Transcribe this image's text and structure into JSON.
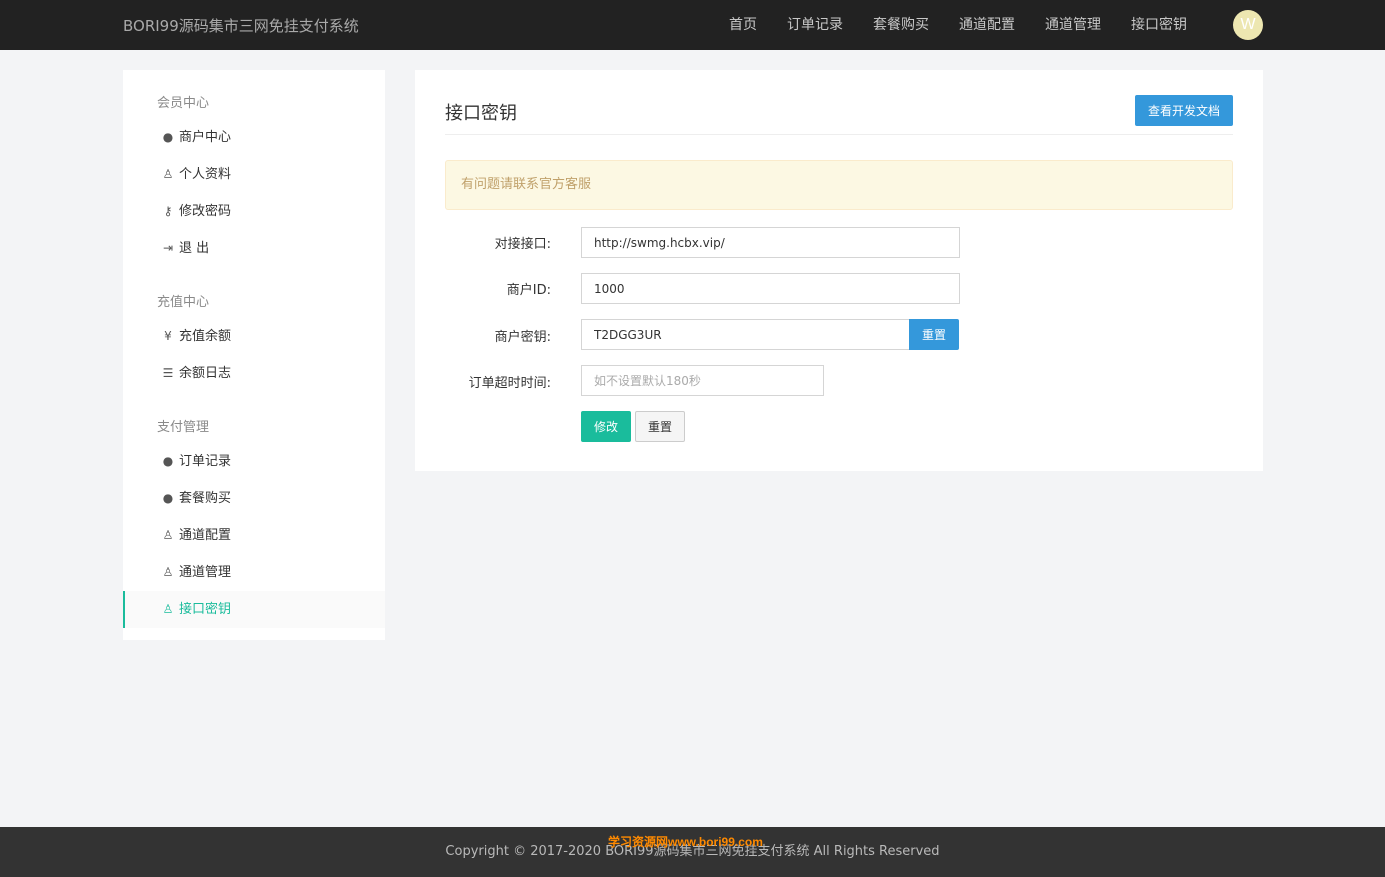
{
  "header": {
    "brand": "BORI99源码集市三网免挂支付系统",
    "nav": [
      "首页",
      "订单记录",
      "套餐购买",
      "通道配置",
      "通道管理",
      "接口密钥"
    ],
    "avatar_letter": "W"
  },
  "sidebar": {
    "groups": [
      {
        "title": "会员中心",
        "items": [
          {
            "label": "商户中心",
            "icon": "user-circle-icon"
          },
          {
            "label": "个人资料",
            "icon": "user-outline-icon"
          },
          {
            "label": "修改密码",
            "icon": "key-icon"
          },
          {
            "label": "退 出",
            "icon": "sign-out-icon"
          }
        ]
      },
      {
        "title": "充值中心",
        "items": [
          {
            "label": "充值余额",
            "icon": "yen-icon"
          },
          {
            "label": "余额日志",
            "icon": "list-icon"
          }
        ]
      },
      {
        "title": "支付管理",
        "items": [
          {
            "label": "订单记录",
            "icon": "user-circle-icon"
          },
          {
            "label": "套餐购买",
            "icon": "user-circle-icon"
          },
          {
            "label": "通道配置",
            "icon": "user-outline-icon"
          },
          {
            "label": "通道管理",
            "icon": "user-outline-icon"
          },
          {
            "label": "接口密钥",
            "icon": "user-outline-icon",
            "active": true
          }
        ]
      }
    ]
  },
  "main": {
    "title": "接口密钥",
    "doc_button": "查看开发文档",
    "alert": "有问题请联系官方客服",
    "form": {
      "api_label": "对接接口:",
      "api_value": "http://swmg.hcbx.vip/",
      "merchant_id_label": "商户ID:",
      "merchant_id_value": "1000",
      "merchant_key_label": "商户密钥:",
      "merchant_key_value": "T2DGG3UR",
      "merchant_key_reset": "重置",
      "timeout_label": "订单超时时间:",
      "timeout_placeholder": "如不设置默认180秒",
      "submit": "修改",
      "reset": "重置"
    }
  },
  "footer": {
    "copyright": "Copyright © 2017-2020 BORI99源码集市三网免挂支付系统 All Rights Reserved",
    "watermark": "学习资源网www.bori99.com"
  },
  "colors": {
    "accent_green": "#1abc9c",
    "accent_blue": "#3498db",
    "topbar": "#222222"
  }
}
